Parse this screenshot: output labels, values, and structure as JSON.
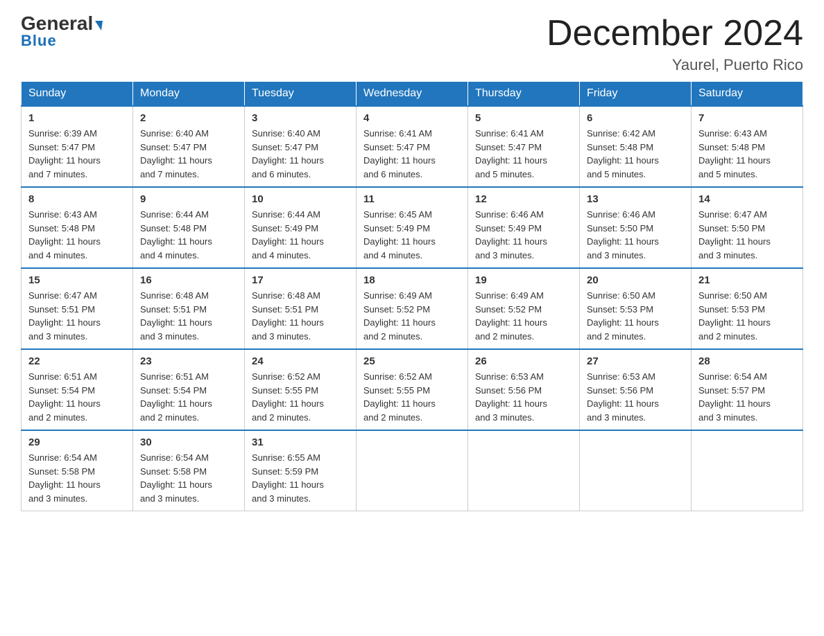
{
  "header": {
    "logo_general": "General",
    "logo_blue": "Blue",
    "month_title": "December 2024",
    "location": "Yaurel, Puerto Rico"
  },
  "days_of_week": [
    "Sunday",
    "Monday",
    "Tuesday",
    "Wednesday",
    "Thursday",
    "Friday",
    "Saturday"
  ],
  "weeks": [
    [
      {
        "day": "1",
        "sunrise": "6:39 AM",
        "sunset": "5:47 PM",
        "daylight": "11 hours and 7 minutes."
      },
      {
        "day": "2",
        "sunrise": "6:40 AM",
        "sunset": "5:47 PM",
        "daylight": "11 hours and 7 minutes."
      },
      {
        "day": "3",
        "sunrise": "6:40 AM",
        "sunset": "5:47 PM",
        "daylight": "11 hours and 6 minutes."
      },
      {
        "day": "4",
        "sunrise": "6:41 AM",
        "sunset": "5:47 PM",
        "daylight": "11 hours and 6 minutes."
      },
      {
        "day": "5",
        "sunrise": "6:41 AM",
        "sunset": "5:47 PM",
        "daylight": "11 hours and 5 minutes."
      },
      {
        "day": "6",
        "sunrise": "6:42 AM",
        "sunset": "5:48 PM",
        "daylight": "11 hours and 5 minutes."
      },
      {
        "day": "7",
        "sunrise": "6:43 AM",
        "sunset": "5:48 PM",
        "daylight": "11 hours and 5 minutes."
      }
    ],
    [
      {
        "day": "8",
        "sunrise": "6:43 AM",
        "sunset": "5:48 PM",
        "daylight": "11 hours and 4 minutes."
      },
      {
        "day": "9",
        "sunrise": "6:44 AM",
        "sunset": "5:48 PM",
        "daylight": "11 hours and 4 minutes."
      },
      {
        "day": "10",
        "sunrise": "6:44 AM",
        "sunset": "5:49 PM",
        "daylight": "11 hours and 4 minutes."
      },
      {
        "day": "11",
        "sunrise": "6:45 AM",
        "sunset": "5:49 PM",
        "daylight": "11 hours and 4 minutes."
      },
      {
        "day": "12",
        "sunrise": "6:46 AM",
        "sunset": "5:49 PM",
        "daylight": "11 hours and 3 minutes."
      },
      {
        "day": "13",
        "sunrise": "6:46 AM",
        "sunset": "5:50 PM",
        "daylight": "11 hours and 3 minutes."
      },
      {
        "day": "14",
        "sunrise": "6:47 AM",
        "sunset": "5:50 PM",
        "daylight": "11 hours and 3 minutes."
      }
    ],
    [
      {
        "day": "15",
        "sunrise": "6:47 AM",
        "sunset": "5:51 PM",
        "daylight": "11 hours and 3 minutes."
      },
      {
        "day": "16",
        "sunrise": "6:48 AM",
        "sunset": "5:51 PM",
        "daylight": "11 hours and 3 minutes."
      },
      {
        "day": "17",
        "sunrise": "6:48 AM",
        "sunset": "5:51 PM",
        "daylight": "11 hours and 3 minutes."
      },
      {
        "day": "18",
        "sunrise": "6:49 AM",
        "sunset": "5:52 PM",
        "daylight": "11 hours and 2 minutes."
      },
      {
        "day": "19",
        "sunrise": "6:49 AM",
        "sunset": "5:52 PM",
        "daylight": "11 hours and 2 minutes."
      },
      {
        "day": "20",
        "sunrise": "6:50 AM",
        "sunset": "5:53 PM",
        "daylight": "11 hours and 2 minutes."
      },
      {
        "day": "21",
        "sunrise": "6:50 AM",
        "sunset": "5:53 PM",
        "daylight": "11 hours and 2 minutes."
      }
    ],
    [
      {
        "day": "22",
        "sunrise": "6:51 AM",
        "sunset": "5:54 PM",
        "daylight": "11 hours and 2 minutes."
      },
      {
        "day": "23",
        "sunrise": "6:51 AM",
        "sunset": "5:54 PM",
        "daylight": "11 hours and 2 minutes."
      },
      {
        "day": "24",
        "sunrise": "6:52 AM",
        "sunset": "5:55 PM",
        "daylight": "11 hours and 2 minutes."
      },
      {
        "day": "25",
        "sunrise": "6:52 AM",
        "sunset": "5:55 PM",
        "daylight": "11 hours and 2 minutes."
      },
      {
        "day": "26",
        "sunrise": "6:53 AM",
        "sunset": "5:56 PM",
        "daylight": "11 hours and 3 minutes."
      },
      {
        "day": "27",
        "sunrise": "6:53 AM",
        "sunset": "5:56 PM",
        "daylight": "11 hours and 3 minutes."
      },
      {
        "day": "28",
        "sunrise": "6:54 AM",
        "sunset": "5:57 PM",
        "daylight": "11 hours and 3 minutes."
      }
    ],
    [
      {
        "day": "29",
        "sunrise": "6:54 AM",
        "sunset": "5:58 PM",
        "daylight": "11 hours and 3 minutes."
      },
      {
        "day": "30",
        "sunrise": "6:54 AM",
        "sunset": "5:58 PM",
        "daylight": "11 hours and 3 minutes."
      },
      {
        "day": "31",
        "sunrise": "6:55 AM",
        "sunset": "5:59 PM",
        "daylight": "11 hours and 3 minutes."
      },
      null,
      null,
      null,
      null
    ]
  ],
  "labels": {
    "sunrise_prefix": "Sunrise: ",
    "sunset_prefix": "Sunset: ",
    "daylight_prefix": "Daylight: "
  }
}
